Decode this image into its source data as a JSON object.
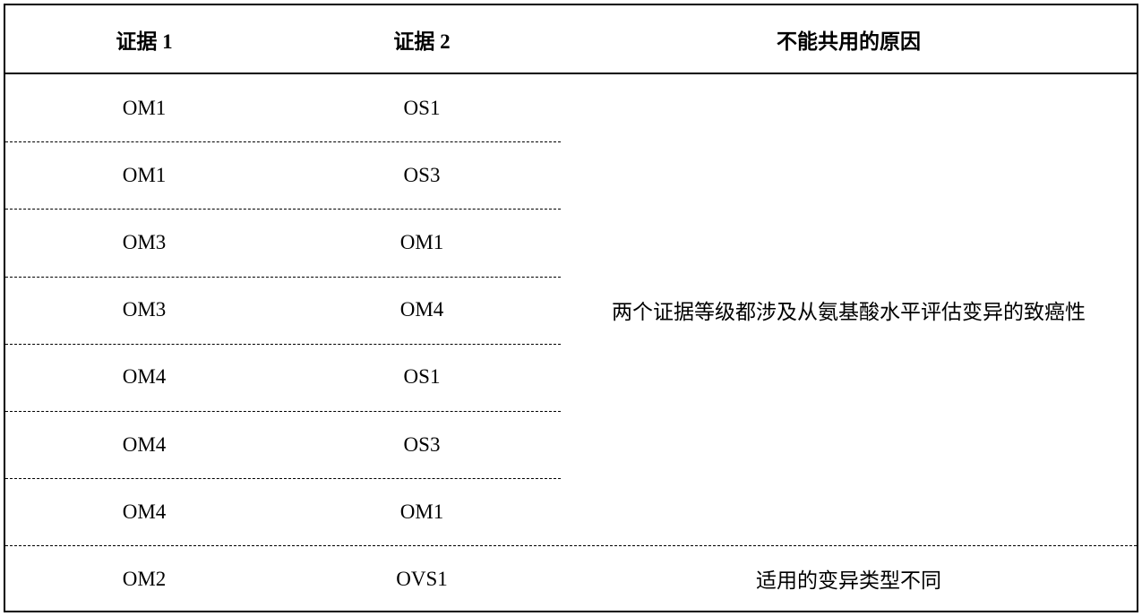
{
  "headers": [
    "证据 1",
    "证据 2",
    "不能共用的原因"
  ],
  "rows": [
    [
      "OM1",
      "OS1"
    ],
    [
      "OM1",
      "OS3"
    ],
    [
      "OM3",
      "OM1"
    ],
    [
      "OM3",
      "OM4"
    ],
    [
      "OM4",
      "OS1"
    ],
    [
      "OM4",
      "OS3"
    ],
    [
      "OM4",
      "OM1"
    ],
    [
      "OM2",
      "OVS1"
    ]
  ],
  "reasons": [
    "两个证据等级都涉及从氨基酸水平评估变异的致癌性",
    "适用的变异类型不同"
  ]
}
